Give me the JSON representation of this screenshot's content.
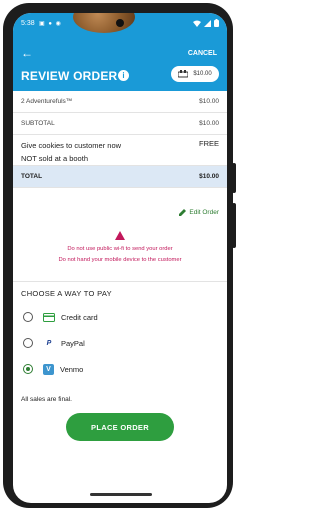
{
  "status": {
    "time": "5:38",
    "left_icons": "▣ ● ◉"
  },
  "appbar": {
    "back_icon": "back-arrow-icon",
    "cancel_label": "CANCEL",
    "title": "REVIEW ORDER",
    "cart_total": "$10.00"
  },
  "order": {
    "items": [
      {
        "label": "2 Adventurefuls™",
        "value": "$10.00"
      }
    ],
    "subtotal": {
      "label": "SUBTOTAL",
      "value": "$10.00"
    },
    "donation": {
      "line1": "Give cookies to customer now",
      "line2": "NOT sold at a booth",
      "value": "FREE"
    },
    "total": {
      "label": "TOTAL",
      "value": "$10.00"
    }
  },
  "edit_order_label": "Edit Order",
  "warnings": {
    "line1": "Do not use public wi-fi to send your order",
    "line2": "Do not hand your mobile device to the customer"
  },
  "payment": {
    "title": "CHOOSE A WAY TO PAY",
    "options": [
      {
        "label": "Credit card",
        "icon": "credit-card-icon",
        "selected": false,
        "color": "#2e9e3f"
      },
      {
        "label": "PayPal",
        "icon": "paypal-icon",
        "selected": false,
        "color": "#1a3d8f"
      },
      {
        "label": "Venmo",
        "icon": "venmo-icon",
        "selected": true,
        "color": "#3d95ce"
      }
    ]
  },
  "final_note": "All sales are final.",
  "place_order_label": "PLACE ORDER",
  "colors": {
    "primary": "#1a9ad7",
    "accent": "#2e9e3f",
    "warning": "#c2185b",
    "total_bg": "#dce8f5"
  }
}
